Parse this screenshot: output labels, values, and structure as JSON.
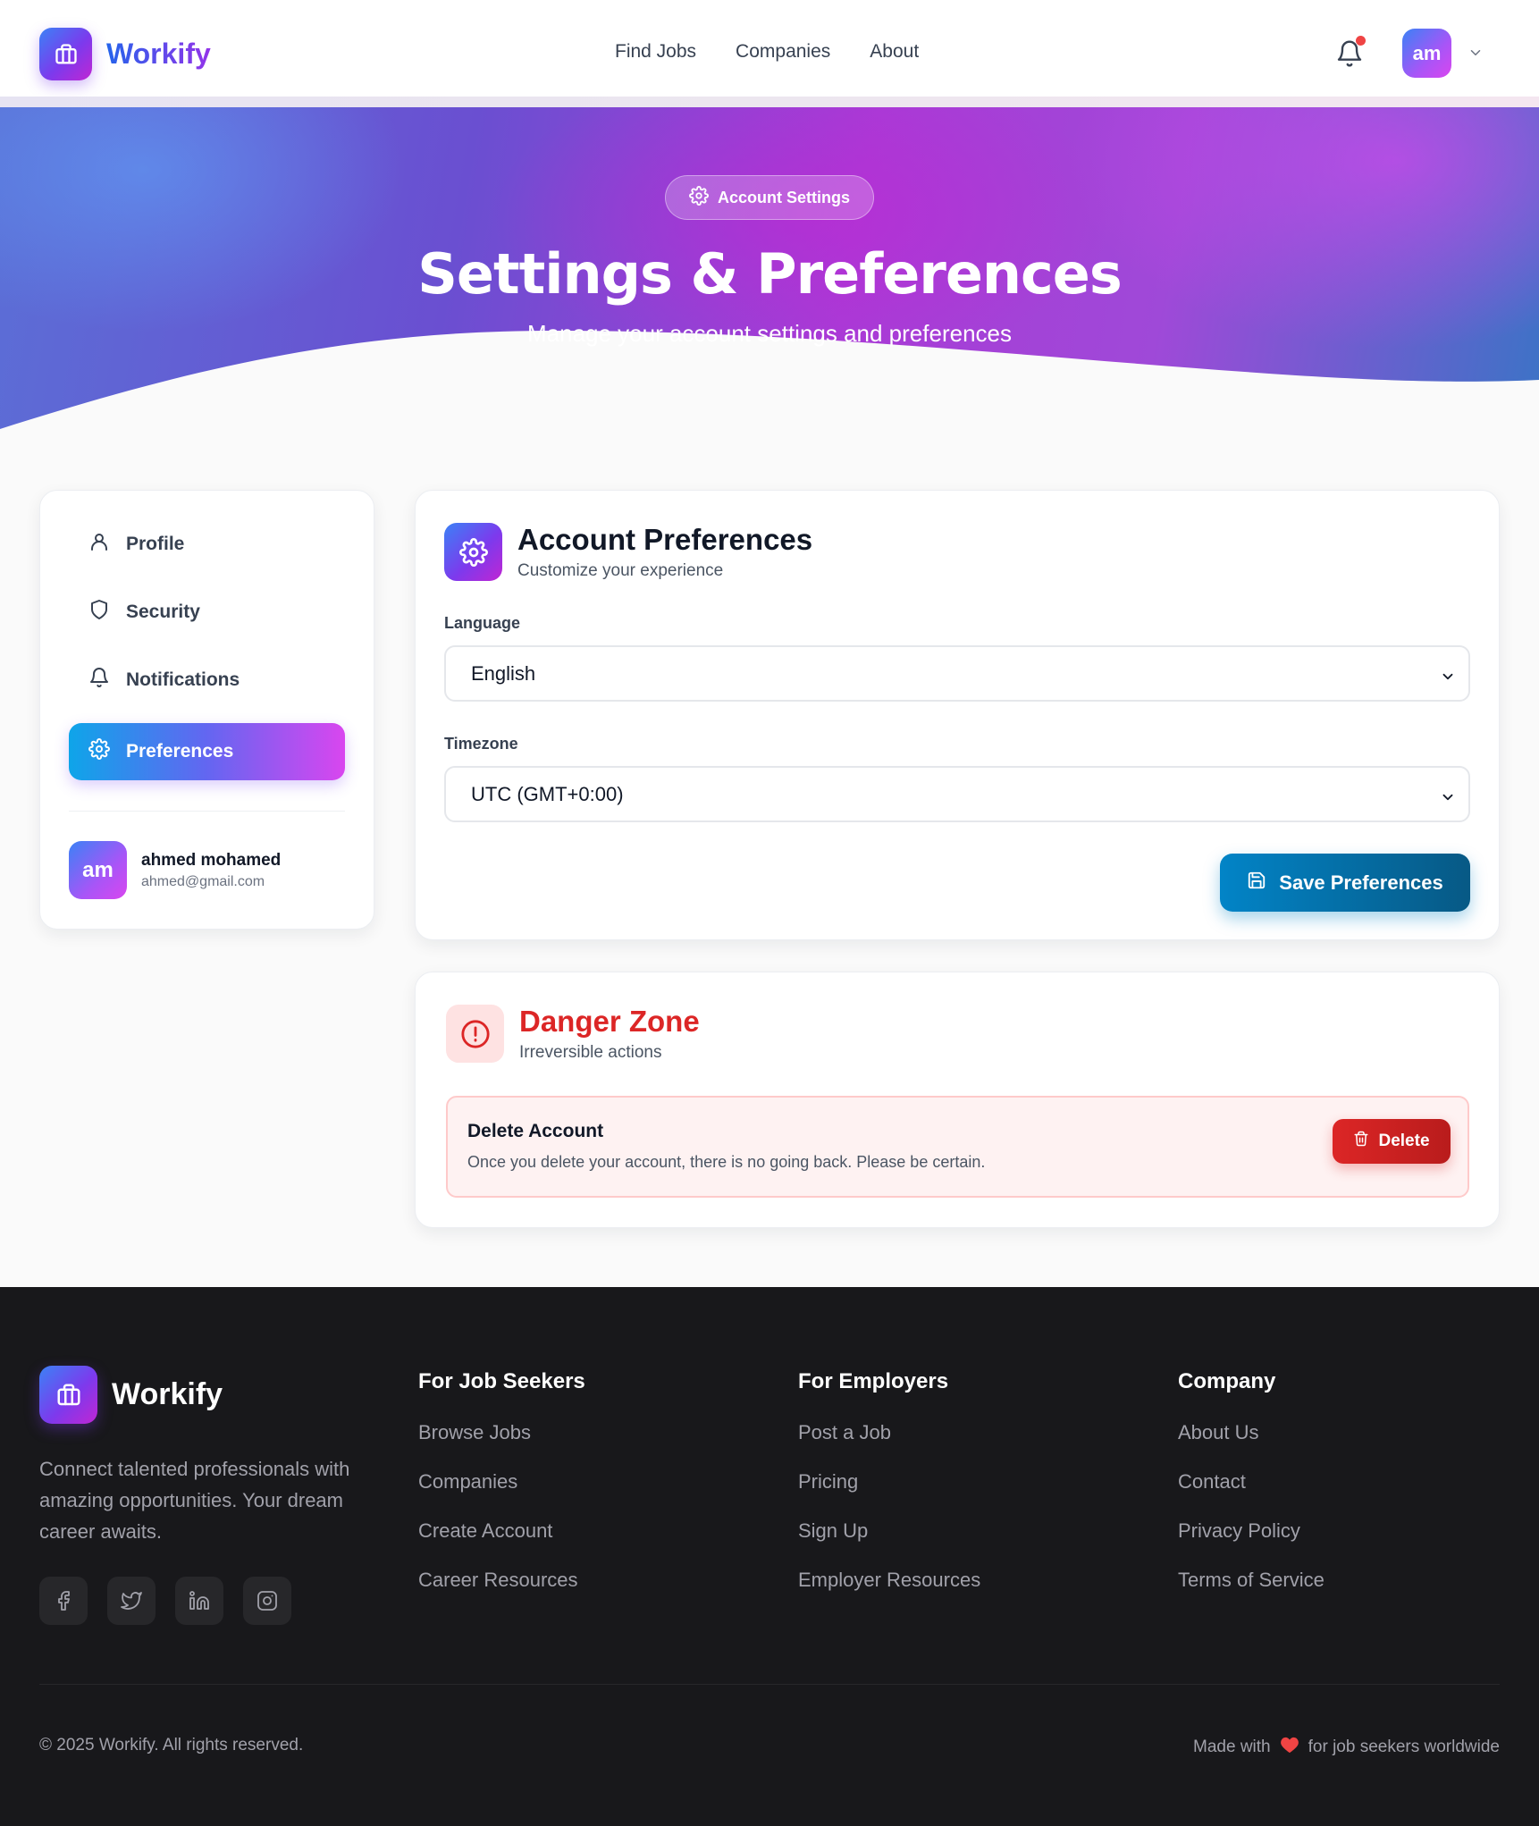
{
  "header": {
    "logo_text": "Workify",
    "nav": [
      "Find Jobs",
      "Companies",
      "About"
    ],
    "avatar_initials": "am",
    "notification_dot": true
  },
  "hero": {
    "badge": "Account Settings",
    "title": "Settings & Preferences",
    "subtitle": "Manage your account settings and preferences"
  },
  "sidebar": {
    "items": [
      {
        "label": "Profile",
        "icon": "user-icon",
        "active": false
      },
      {
        "label": "Security",
        "icon": "shield-icon",
        "active": false
      },
      {
        "label": "Notifications",
        "icon": "bell-icon",
        "active": false
      },
      {
        "label": "Preferences",
        "icon": "gear-icon",
        "active": true
      }
    ],
    "user": {
      "initials": "am",
      "name": "ahmed mohamed",
      "email": "ahmed@gmail.com"
    }
  },
  "preferences": {
    "title": "Account Preferences",
    "subtitle": "Customize your experience",
    "language_label": "Language",
    "language_value": "English",
    "timezone_label": "Timezone",
    "timezone_value": "UTC (GMT+0:00)",
    "save_label": "Save Preferences"
  },
  "danger": {
    "title": "Danger Zone",
    "subtitle": "Irreversible actions",
    "box_title": "Delete Account",
    "box_text": "Once you delete your account, there is no going back. Please be certain.",
    "delete_label": "Delete"
  },
  "footer": {
    "logo_text": "Workify",
    "description": "Connect talented professionals with amazing opportunities. Your dream career awaits.",
    "socials": [
      "facebook-icon",
      "twitter-icon",
      "linkedin-icon",
      "instagram-icon"
    ],
    "columns": [
      {
        "title": "For Job Seekers",
        "links": [
          "Browse Jobs",
          "Companies",
          "Create Account",
          "Career Resources"
        ]
      },
      {
        "title": "For Employers",
        "links": [
          "Post a Job",
          "Pricing",
          "Sign Up",
          "Employer Resources"
        ]
      },
      {
        "title": "Company",
        "links": [
          "About Us",
          "Contact",
          "Privacy Policy",
          "Terms of Service"
        ]
      }
    ],
    "copyright": "© 2025 Workify. All rights reserved.",
    "made_with_prefix": "Made with",
    "made_with_suffix": "for job seekers worldwide"
  },
  "colors": {
    "brand_blue": "#2563eb",
    "brand_purple": "#9333ea",
    "brand_magenta": "#d946ef",
    "save_button": "#0284c7",
    "danger": "#dc2626",
    "footer_bg": "#18181b"
  }
}
